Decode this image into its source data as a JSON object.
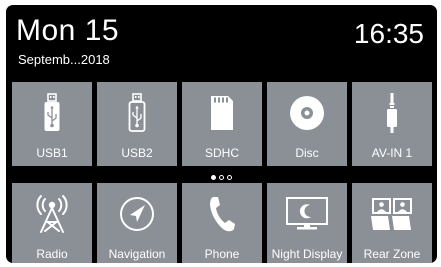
{
  "header": {
    "day": "Mon  15",
    "date_line": "Septemb...2018",
    "time": "16:35"
  },
  "row1": [
    {
      "label": "USB1",
      "icon": "usb-icon"
    },
    {
      "label": "USB2",
      "icon": "usb-icon"
    },
    {
      "label": "SDHC",
      "icon": "sd-card-icon"
    },
    {
      "label": "Disc",
      "icon": "disc-icon"
    },
    {
      "label": "AV-IN 1",
      "icon": "av-in-icon"
    }
  ],
  "row2": [
    {
      "label": "Radio",
      "icon": "radio-tower-icon"
    },
    {
      "label": "Navigation",
      "icon": "navigation-icon"
    },
    {
      "label": "Phone",
      "icon": "phone-icon"
    },
    {
      "label": "Night Display",
      "icon": "night-display-icon"
    },
    {
      "label": "Rear Zone",
      "icon": "rear-zone-icon"
    }
  ],
  "pager": {
    "pages": 3,
    "current": 1
  },
  "colors": {
    "background": "#000000",
    "tile": "#8b9096",
    "text": "#ffffff"
  }
}
